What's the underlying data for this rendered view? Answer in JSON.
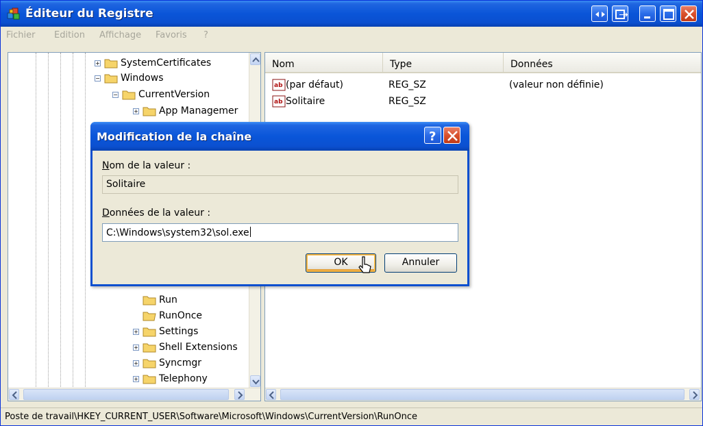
{
  "window": {
    "title": "Éditeur du Registre"
  },
  "menu": [
    "Fichier",
    "Edition",
    "Affichage",
    "Favoris",
    "?"
  ],
  "tree": {
    "nodes": [
      {
        "label": "SystemCertificates",
        "expander": "+"
      },
      {
        "label": "Windows",
        "expander": "−"
      },
      {
        "label": "CurrentVersion",
        "expander": "−"
      },
      {
        "label": "App Managemer",
        "expander": "+"
      },
      {
        "label": "Run",
        "expander": ""
      },
      {
        "label": "RunOnce",
        "expander": ""
      },
      {
        "label": "Settings",
        "expander": "+"
      },
      {
        "label": "Shell Extensions",
        "expander": "+"
      },
      {
        "label": "Syncmgr",
        "expander": "+"
      },
      {
        "label": "Telephony",
        "expander": "+"
      }
    ]
  },
  "list": {
    "headers": [
      "Nom",
      "Type",
      "Données"
    ],
    "rows": [
      {
        "name": "(par défaut)",
        "type": "REG_SZ",
        "data": "(valeur non définie)"
      },
      {
        "name": "Solitaire",
        "type": "REG_SZ",
        "data": ""
      }
    ]
  },
  "status": {
    "path": "Poste de travail\\HKEY_CURRENT_USER\\Software\\Microsoft\\Windows\\CurrentVersion\\RunOnce"
  },
  "dialog": {
    "title": "Modification de la chaîne",
    "value_name_label": "Nom de la valeur :",
    "value_name_accel": "N",
    "value_name_rest": "om de la valeur :",
    "value_name": "Solitaire",
    "value_data_label": "Données de la valeur :",
    "value_data_accel": "D",
    "value_data_rest": "onnées de la valeur :",
    "value_data": "C:\\Windows\\system32\\sol.exe",
    "ok_label": "OK",
    "cancel_label": "Annuler",
    "help_glyph": "?"
  },
  "colors": {
    "title_blue": "#0a55d8",
    "close_red": "#d9512d",
    "face": "#ece9d8",
    "default_button_glow": "#f9b844"
  }
}
